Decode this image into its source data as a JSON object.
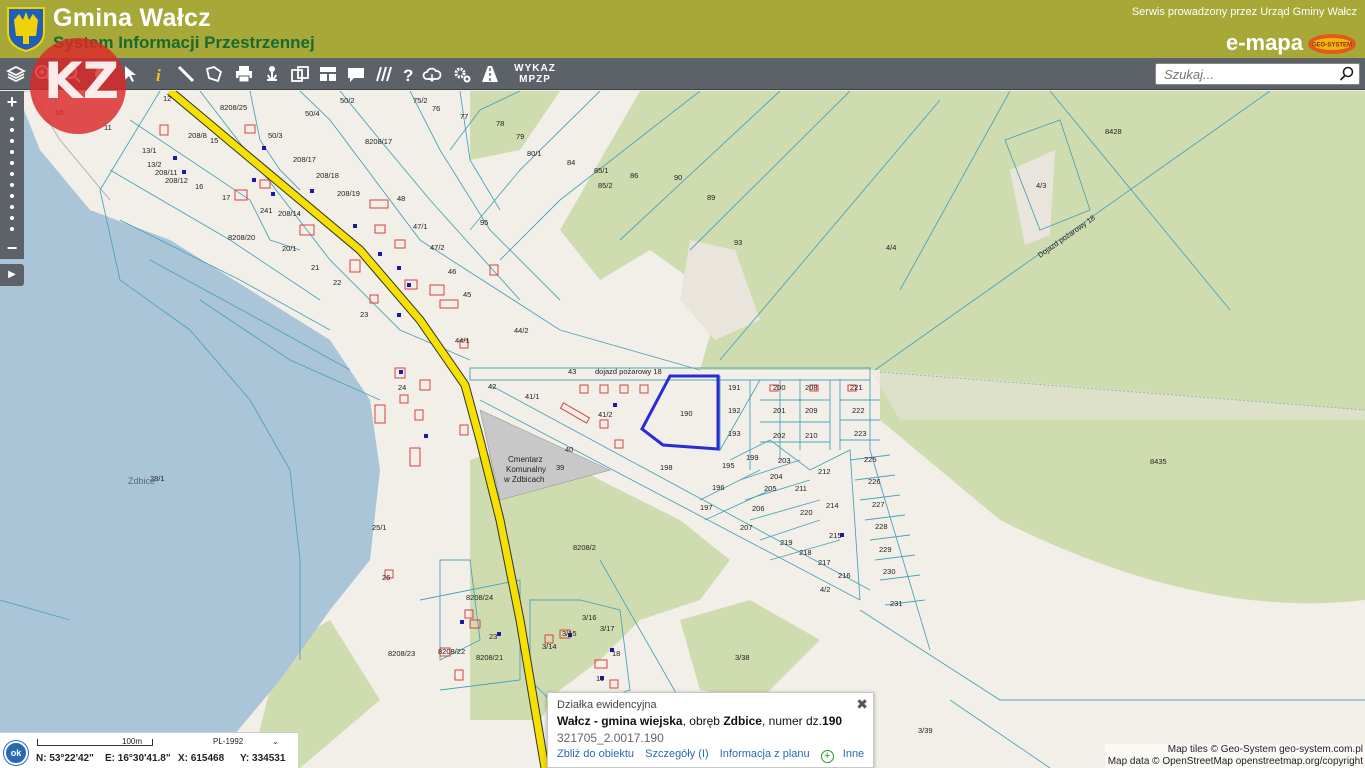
{
  "header": {
    "title": "Gmina Wałcz",
    "subtitle": "System Informacji Przestrzennej",
    "service": "Serwis prowadzony przez Urząd Gminy Wałcz",
    "brand": "e-mapa",
    "brand_badge": "GEO-SYSTEM"
  },
  "toolbar": {
    "tools": [
      "layers-icon",
      "zoom-in-icon",
      "zoom-out-icon",
      "zoom-full-icon",
      "select-arrow-icon",
      "info-icon",
      "measure-line-icon",
      "measure-area-icon",
      "print-icon",
      "position-icon",
      "compare-icon",
      "layout-icon",
      "comment-icon",
      "hatch-icon",
      "help-icon",
      "cloud-icon",
      "settings-icon",
      "road-icon"
    ],
    "wykaz": "WYKAZ MPZP",
    "search_placeholder": "Szukaj..."
  },
  "map": {
    "labels_top": [
      "8208/25",
      "50/4",
      "50/2",
      "75/2",
      "76",
      "77",
      "78",
      "79",
      "80/1",
      "84",
      "85/1",
      "85/2",
      "86",
      "90",
      "89",
      "93",
      "8428",
      "4/3",
      "4/4"
    ],
    "labels_village": [
      "12",
      "10",
      "11",
      "208/8",
      "15",
      "13/1",
      "13/2",
      "208/11",
      "208/12",
      "16",
      "50/3",
      "8208/17",
      "208/17",
      "208/18",
      "208/19",
      "17",
      "241",
      "208/14",
      "48",
      "47/1",
      "47/2",
      "8208/20",
      "20/1",
      "21",
      "22",
      "46",
      "45",
      "23",
      "95",
      "44/2",
      "44/1",
      "24",
      "42",
      "41/1",
      "41/2",
      "43",
      "40",
      "190",
      "191",
      "192",
      "193",
      "198",
      "195",
      "196",
      "197",
      "199",
      "200",
      "201",
      "202",
      "203",
      "204",
      "205",
      "206",
      "207",
      "208",
      "209",
      "210",
      "211",
      "212",
      "214",
      "215",
      "216",
      "217",
      "218",
      "219",
      "220",
      "221",
      "222",
      "223",
      "225",
      "226",
      "227",
      "228",
      "229",
      "230",
      "231",
      "25/1",
      "26",
      "8208/2",
      "8208/24",
      "8208/23",
      "8208/22",
      "8208/21",
      "23",
      "3/16",
      "3/15",
      "3/17",
      "3/14",
      "18",
      "19",
      "3/38",
      "4/2",
      "8435",
      "3/39",
      "28/1",
      "39"
    ],
    "road_label": "dojazd pożarowy 18",
    "road_label2": "Dojazd pożarowy 18",
    "lake_label": "Zdbice",
    "cemetery_label_1": "Cmentarz",
    "cemetery_label_2": "Komunalny",
    "cemetery_label_3": "w Zdbicach",
    "selected_parcel": "190"
  },
  "popup": {
    "header": "Działka ewidencyjna",
    "name": "Wałcz - gmina wiejska",
    "mid": ", obręb ",
    "precinct": "Zdbice",
    "tail": ", numer dz.",
    "number": "190",
    "id": "321705_2.0017.190",
    "links": [
      "Zbliż do obiektu",
      "Szczegóły (I)",
      "Informacja z planu",
      "Inne"
    ]
  },
  "status": {
    "ok": "ok",
    "scale": "100m",
    "crs": "PL-1992",
    "n": "N: 53°22'42\"",
    "e": "E: 16°30'41.8\"",
    "x": "X: 615468",
    "y": "Y: 334531"
  },
  "attribution": {
    "line1": "Map tiles © Geo-System geo-system.com.pl",
    "line2": "Map data © OpenStreetMap openstreetmap.org/copyright"
  },
  "overlay": {
    "kz": "KZ"
  },
  "colors": {
    "header": "#a7a838",
    "toolbar": "#5d6269",
    "water": "#aac4d8",
    "forest": "#cfdcb0",
    "road": "#f5e000",
    "parcel_line": "#4fa3b6",
    "building": "#d94040",
    "selection": "#2b2bd8"
  }
}
